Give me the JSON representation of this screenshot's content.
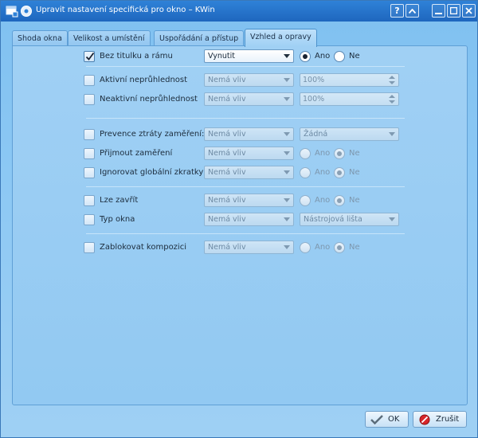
{
  "window": {
    "title": "Upravit nastavení specifická pro okno – KWin",
    "icons": [
      "window-icon",
      "settings-icon"
    ],
    "controls": [
      "help-icon",
      "keep-above-icon",
      "minimize-icon",
      "maximize-icon",
      "close-icon"
    ]
  },
  "tabs": [
    {
      "label": "Shoda okna"
    },
    {
      "label": "Velikost a umístění"
    },
    {
      "label": "Uspořádání a přístup"
    },
    {
      "label": "Vzhled a opravy"
    }
  ],
  "rows": {
    "noborder": {
      "label": "Bez titulku a rámu",
      "checked": true,
      "policy": "Vynutit",
      "yes": "Ano",
      "no": "Ne",
      "value": "yes"
    },
    "opacity_active": {
      "label": "Aktivní neprůhlednost",
      "policy": "Nemá vliv",
      "value": "100%"
    },
    "opacity_inactive": {
      "label": "Neaktivní neprůhlednost",
      "policy": "Nemá vliv",
      "value": "100%"
    },
    "focus_stealing": {
      "label": "Prevence ztráty zaměření:",
      "policy": "Nemá vliv",
      "value": "Žádná"
    },
    "accept_focus": {
      "label": "Přijmout zaměření",
      "policy": "Nemá vliv",
      "yes": "Ano",
      "no": "Ne",
      "value": "no"
    },
    "ignore_shortcuts": {
      "label": "Ignorovat globální zkratky",
      "policy": "Nemá vliv",
      "yes": "Ano",
      "no": "Ne",
      "value": "no"
    },
    "closeable": {
      "label": "Lze zavřít",
      "policy": "Nemá vliv",
      "yes": "Ano",
      "no": "Ne",
      "value": "no"
    },
    "window_type": {
      "label": "Typ okna",
      "policy": "Nemá vliv",
      "value": "Nástrojová lišta"
    },
    "block_compositing": {
      "label": "Zablokovat kompozici",
      "policy": "Nemá vliv",
      "yes": "Ano",
      "no": "Ne",
      "value": "no"
    }
  },
  "buttons": {
    "ok": "OK",
    "cancel": "Zrušit"
  }
}
